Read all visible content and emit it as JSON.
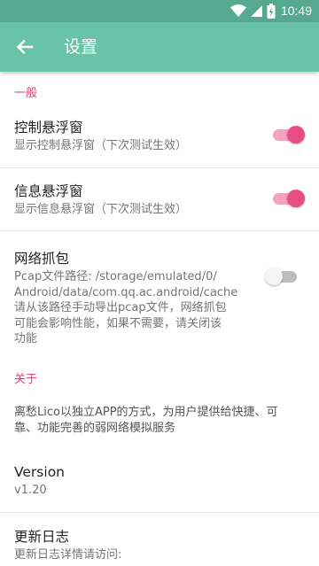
{
  "status_bar": {
    "time": "10:49",
    "icons": [
      "wifi-icon",
      "signal-icon",
      "battery-charging-icon"
    ]
  },
  "app_bar": {
    "back_icon": "arrow-left-icon",
    "title": "设置"
  },
  "sections": {
    "general": {
      "header": "一般",
      "float_control": {
        "title": "控制悬浮窗",
        "summary": "显示控制悬浮窗（下次测试生效）",
        "checked": true
      },
      "float_info": {
        "title": "信息悬浮窗",
        "summary": "显示信息悬浮窗（下次测试生效）",
        "checked": true
      },
      "packet_capture": {
        "title": "网络抓包",
        "summary_lines": [
          "Pcap文件路径: /storage/emulated/0/",
          "Android/data/com.qq.ac.android/cache",
          "请从该路径手动导出pcap文件，网络抓包",
          "可能会影响性能，如果不需要，请关闭该",
          "功能"
        ],
        "checked": false
      }
    },
    "about": {
      "header": "关于",
      "description_lines": [
        "离愁Lico以独立APP的方式，为用户提供给快捷、可",
        "靠、功能完善的弱网络模拟服务"
      ],
      "version": {
        "title": "Version",
        "value": "v1.20"
      },
      "changelog": {
        "title": "更新日志",
        "summary": "更新日志详情请访问:"
      }
    }
  },
  "colors": {
    "status_bar": "#56a88e",
    "app_bar": "#69c4a7",
    "accent": "#e94d84",
    "section_header": "#e0427a"
  }
}
